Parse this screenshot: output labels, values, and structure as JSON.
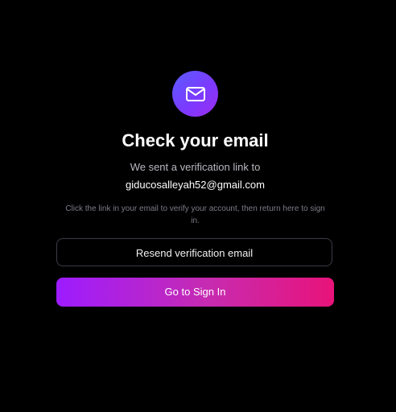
{
  "colors": {
    "background": "#000000",
    "badge_gradient_start": "#5b5cff",
    "badge_gradient_end": "#9b2cf0",
    "primary_gradient_start": "#9d1cff",
    "primary_gradient_end": "#e8137a",
    "outline_border": "#3c3c46",
    "muted_text": "#b9b9c2",
    "hint_text": "#7c7c88"
  },
  "header": {
    "icon": "mail-icon",
    "title": "Check your email"
  },
  "message": {
    "sent_line": "We sent a verification link to",
    "email": "giducosalleyah52@gmail.com",
    "hint": "Click the link in your email to verify your account, then return here to sign in."
  },
  "actions": {
    "resend_label": "Resend verification email",
    "signin_label": "Go to Sign In"
  }
}
